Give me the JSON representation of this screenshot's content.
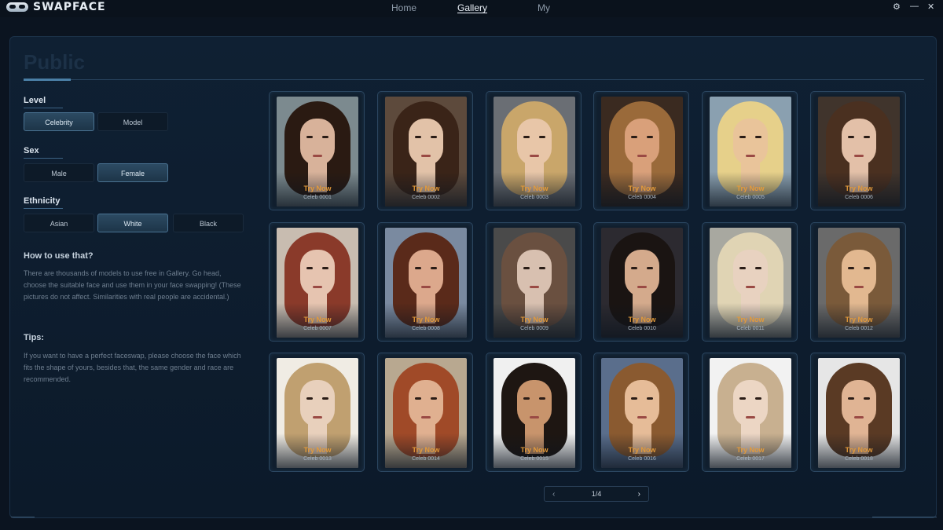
{
  "app": {
    "name": "SWAPFACE"
  },
  "nav": [
    {
      "label": "Home",
      "active": false
    },
    {
      "label": "Gallery",
      "active": true
    },
    {
      "label": "My",
      "active": false
    }
  ],
  "window_controls": {
    "settings": "⚙",
    "minimize": "—",
    "close": "✕"
  },
  "page": {
    "title": "Public"
  },
  "filters": {
    "level": {
      "label": "Level",
      "options": [
        "Celebrity",
        "Model"
      ],
      "selected": "Celebrity"
    },
    "sex": {
      "label": "Sex",
      "options": [
        "Male",
        "Female"
      ],
      "selected": "Female"
    },
    "ethnicity": {
      "label": "Ethnicity",
      "options": [
        "Asian",
        "White",
        "Black"
      ],
      "selected": "White"
    }
  },
  "help": {
    "how_title": "How to use that?",
    "how_text": "There are thousands of models to use free in Gallery. Go head, choose the suitable face and use them in your face swapping! (These pictures do not affect. Similarities with real people are accidental.)",
    "tips_title": "Tips:",
    "tips_text": "If you want to have a perfect faceswap, please choose the face which fits the shape of yours, besides that, the same gender and race are recommended."
  },
  "cards": [
    {
      "try": "Try Now",
      "name": "Celeb 0001"
    },
    {
      "try": "Try Now",
      "name": "Celeb 0002"
    },
    {
      "try": "Try Now",
      "name": "Celeb 0003"
    },
    {
      "try": "Try Now",
      "name": "Celeb 0004"
    },
    {
      "try": "Try Now",
      "name": "Celeb 0005"
    },
    {
      "try": "Try Now",
      "name": "Celeb 0006"
    },
    {
      "try": "Try Now",
      "name": "Celeb 0007"
    },
    {
      "try": "Try Now",
      "name": "Celeb 0008"
    },
    {
      "try": "Try Now",
      "name": "Celeb 0009"
    },
    {
      "try": "Try Now",
      "name": "Celeb 0010"
    },
    {
      "try": "Try Now",
      "name": "Celeb 0011"
    },
    {
      "try": "Try Now",
      "name": "Celeb 0012"
    },
    {
      "try": "Try Now",
      "name": "Celeb 0013"
    },
    {
      "try": "Try Now",
      "name": "Celeb 0014"
    },
    {
      "try": "Try Now",
      "name": "Celeb 0015"
    },
    {
      "try": "Try Now",
      "name": "Celeb 0016"
    },
    {
      "try": "Try Now",
      "name": "Celeb 0017"
    },
    {
      "try": "Try Now",
      "name": "Celeb 0018"
    }
  ],
  "pagination": {
    "prev": "‹",
    "page": "1/4",
    "next": "›"
  },
  "colors": {
    "accent": "#e39a3a",
    "selected_chip": "#2c4b63",
    "panel": "#0f2033"
  }
}
